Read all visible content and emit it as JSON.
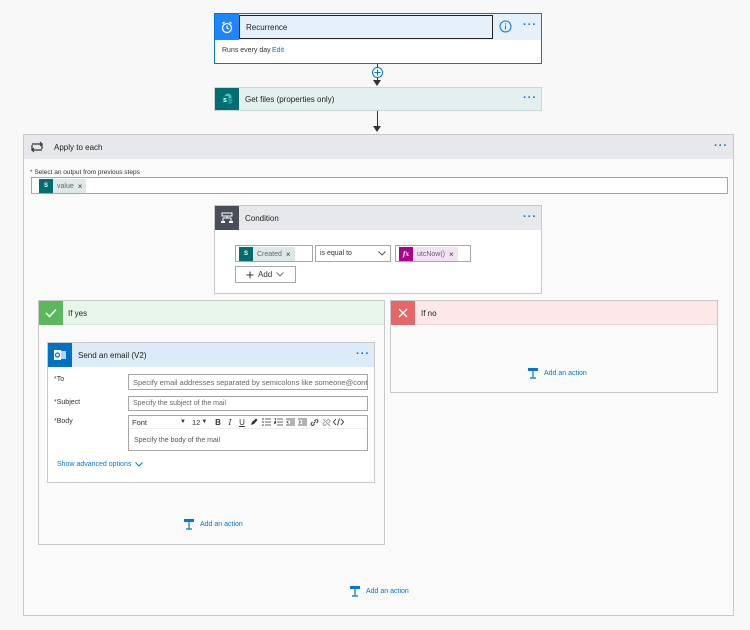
{
  "recurrence": {
    "title": "Recurrence",
    "summary": "Runs every day",
    "edit": "Edit",
    "more": "···"
  },
  "get_files": {
    "title": "Get files (properties only)",
    "more": "···"
  },
  "apply_each": {
    "title": "Apply to each",
    "more": "···",
    "select_label": "Select an output from previous steps",
    "token": "value"
  },
  "condition": {
    "title": "Condition",
    "more": "···",
    "left_token": "Created",
    "operator": "is equal to",
    "right_token": "utcNow()",
    "right_icon": "fx",
    "add": "Add"
  },
  "if_yes": {
    "title": "If yes",
    "add_action": "Add an action"
  },
  "if_no": {
    "title": "If no",
    "add_action": "Add an action"
  },
  "email": {
    "title": "Send an email (V2)",
    "more": "···",
    "to_label": "To",
    "to_placeholder": "Specify email addresses separated by semicolons like someone@contoso.com",
    "subject_label": "Subject",
    "subject_placeholder": "Specify the subject of the mail",
    "body_label": "Body",
    "font": "Font",
    "font_size": "12",
    "body_placeholder": "Specify the body of the mail",
    "advanced": "Show advanced options",
    "required_mark": "*"
  },
  "loop_add_action": "Add an action",
  "colors": {
    "recurrence": "#1f85ff",
    "sharepoint": "#036c70",
    "condition": "#484f58",
    "yes": "#5cb85c",
    "no": "#e66767",
    "outlook": "#0072c6",
    "accent": "#0078d4"
  }
}
